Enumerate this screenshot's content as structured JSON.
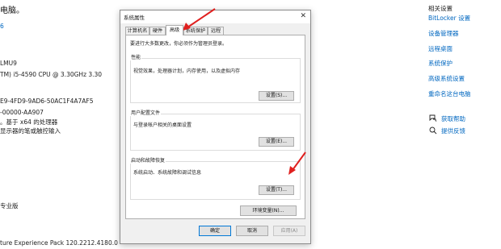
{
  "background": {
    "title": "电脑。",
    "link": "6",
    "lines": [
      "LMU9",
      "TM) i5-4590 CPU @ 3.30GHz   3.30",
      "E9-4FD9-9AD6-50AC1F4A7AF5",
      "-00000-AA907",
      "。基于 x64 的处理器",
      "显示器的笔或触控输入",
      "专业版",
      "ture Experience Pack 120.2212.4180.0"
    ]
  },
  "sidebar": {
    "title": "相关设置",
    "links": [
      "BitLocker 设置",
      "设备管理器",
      "远程桌面",
      "系统保护",
      "高级系统设置",
      "重命名这台电脑"
    ],
    "help": [
      {
        "icon": "help-chat-icon",
        "label": "获取帮助"
      },
      {
        "icon": "feedback-icon",
        "label": "提供反馈"
      }
    ]
  },
  "dialog": {
    "title": "系统属性",
    "close": "✕",
    "tabs": [
      "计算机名",
      "硬件",
      "高级",
      "系统保护",
      "远程"
    ],
    "active_tab": "高级",
    "admin_note": "要进行大多数更改，你必须作为管理员登录。",
    "performance": {
      "label": "性能",
      "desc": "视觉效果，处理器计划，内存使用，以及虚拟内存",
      "button": "设置(S)..."
    },
    "user_profiles": {
      "label": "用户配置文件",
      "desc": "与登录帐户相关的桌面设置",
      "button": "设置(E)..."
    },
    "startup_recovery": {
      "label": "启动和故障恢复",
      "desc": "系统启动、系统故障和调试信息",
      "button": "设置(T)..."
    },
    "env_button": "环境变量(N)...",
    "ok": "确定",
    "cancel": "取消",
    "apply": "应用(A)"
  },
  "colors": {
    "accent": "#0078d7",
    "link": "#0067c0",
    "arrow": "#e0201f"
  }
}
